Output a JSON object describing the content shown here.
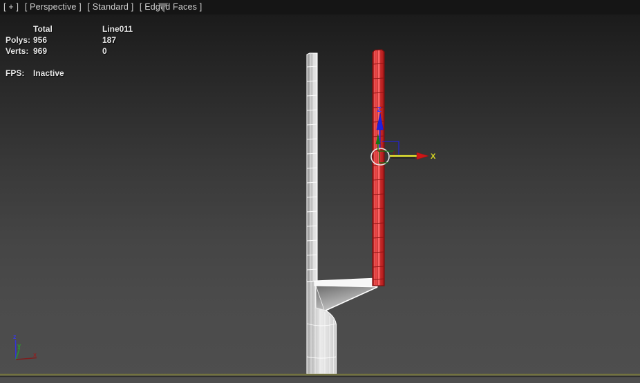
{
  "viewport": {
    "menu_bar": {
      "general_menu": "[ + ]",
      "pov_menu": "[ Perspective ]",
      "shading_renderer": "[ Standard ]",
      "shading_mode": "[ Edged Faces ]"
    },
    "stats": {
      "column_headers": {
        "total": "Total",
        "selected": "Line011"
      },
      "rows": [
        {
          "label": "Polys:",
          "total": "956",
          "selected": "187"
        },
        {
          "label": "Verts:",
          "total": "969",
          "selected": "0"
        }
      ],
      "fps_label": "FPS:",
      "fps_value": "Inactive"
    }
  },
  "selected_object": {
    "name": "Line011",
    "color": "#e23c3c"
  },
  "gizmo": {
    "x_label": "X",
    "z_label": "Z"
  },
  "world_axis": {
    "x_label": "x",
    "y_label": "y",
    "z_label": "z"
  },
  "colors": {
    "selection_red": "#e23c3c",
    "gizmo_x_active_yellow": "#eded2f",
    "gizmo_arrow_red": "#cc1616",
    "gizmo_y_green": "#1f8f1f",
    "gizmo_z_blue": "#2a2aee",
    "ground_line_olive": "#72723f",
    "viewport_bg_top": "#181818",
    "viewport_bg_bottom": "#4e4e4e",
    "label_bar_bg": "#151515"
  }
}
